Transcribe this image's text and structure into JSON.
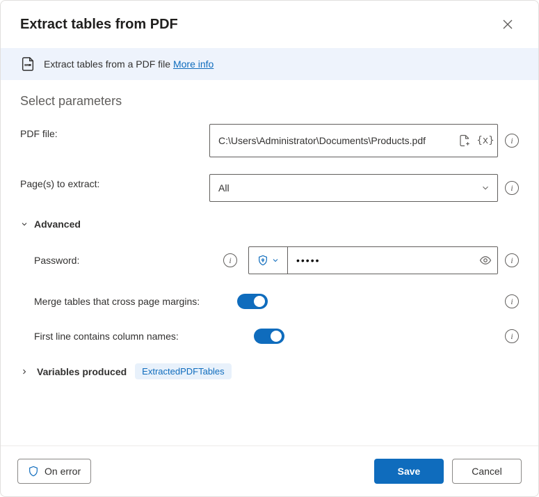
{
  "dialog": {
    "title": "Extract tables from PDF"
  },
  "info_bar": {
    "text": "Extract tables from a PDF file",
    "link": "More info"
  },
  "section_title": "Select parameters",
  "params": {
    "pdf_file": {
      "label": "PDF file:",
      "value": "C:\\Users\\Administrator\\Documents\\Products.pdf"
    },
    "pages": {
      "label": "Page(s) to extract:",
      "value": "All"
    }
  },
  "advanced": {
    "header": "Advanced",
    "password": {
      "label": "Password:",
      "value": "•••••"
    },
    "merge": {
      "label": "Merge tables that cross page margins:",
      "on": true
    },
    "first_line": {
      "label": "First line contains column names:",
      "on": true
    }
  },
  "variables": {
    "label": "Variables produced",
    "pill": "ExtractedPDFTables"
  },
  "footer": {
    "on_error": "On error",
    "save": "Save",
    "cancel": "Cancel"
  }
}
